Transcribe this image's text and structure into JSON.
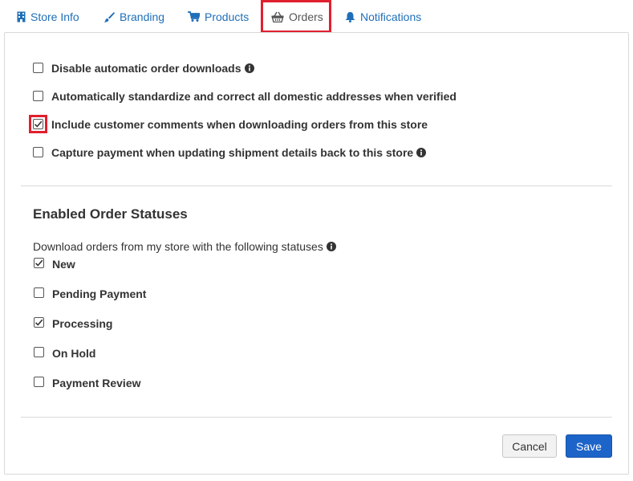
{
  "tabs": [
    {
      "label": "Store Info",
      "icon": "building-icon"
    },
    {
      "label": "Branding",
      "icon": "paintbrush-icon"
    },
    {
      "label": "Products",
      "icon": "cart-icon"
    },
    {
      "label": "Orders",
      "icon": "basket-icon",
      "active": true
    },
    {
      "label": "Notifications",
      "icon": "bell-icon"
    }
  ],
  "order_options": [
    {
      "label": "Disable automatic order downloads",
      "checked": false,
      "info": true
    },
    {
      "label": "Automatically standardize and correct all domestic addresses when verified",
      "checked": false,
      "info": false
    },
    {
      "label": "Include customer comments when downloading orders from this store",
      "checked": true,
      "info": false
    },
    {
      "label": "Capture payment when updating shipment details back to this store",
      "checked": false,
      "info": true
    }
  ],
  "statuses_section": {
    "title": "Enabled Order Statuses",
    "description": "Download orders from my store with the following statuses",
    "statuses": [
      {
        "label": "New",
        "checked": true
      },
      {
        "label": "Pending Payment",
        "checked": false
      },
      {
        "label": "Processing",
        "checked": true
      },
      {
        "label": "On Hold",
        "checked": false
      },
      {
        "label": "Payment Review",
        "checked": false
      }
    ]
  },
  "actions": {
    "cancel_label": "Cancel",
    "save_label": "Save"
  },
  "colors": {
    "link": "#1f6fb8",
    "highlight": "#e0202e",
    "primary": "#1d64c8"
  }
}
